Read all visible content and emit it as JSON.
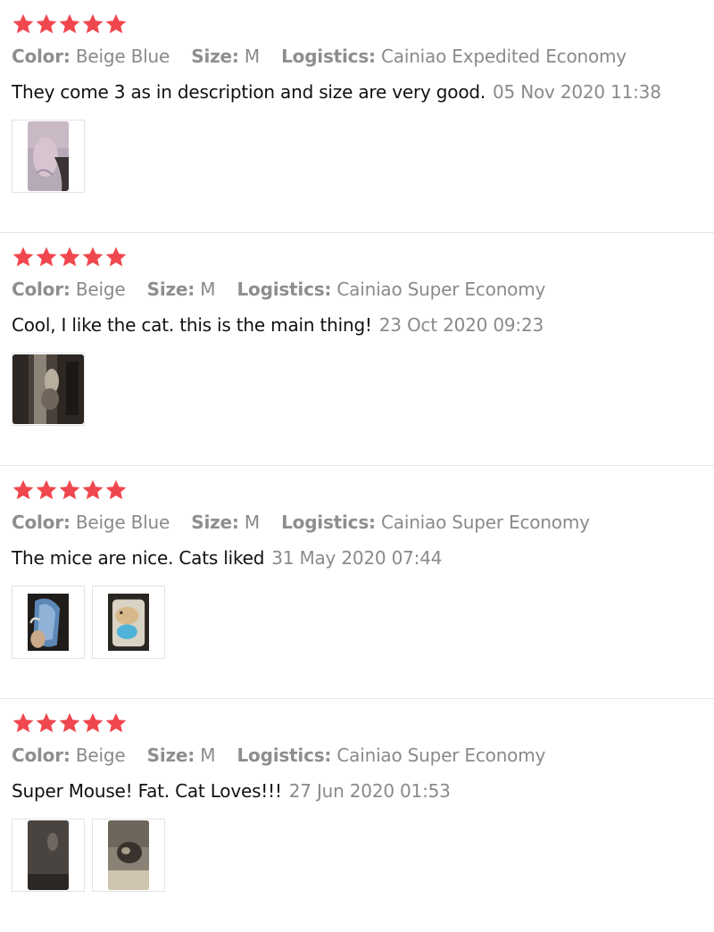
{
  "colors": {
    "star": "#f0474e",
    "muted": "#8a8a8a",
    "text": "#111111",
    "divider": "#e6e6e6"
  },
  "labels": {
    "color": "Color:",
    "size": "Size:",
    "logistics": "Logistics:"
  },
  "reviews": [
    {
      "rating": 5,
      "color": "Beige Blue",
      "size": "M",
      "logistics": "Cainiao Expedited Economy",
      "comment": "They come 3 as in description and size are very good.",
      "date": "05 Nov 2020 11:38",
      "photos": [
        "pale-pink-toy-photo"
      ]
    },
    {
      "rating": 5,
      "color": "Beige",
      "size": "M",
      "logistics": "Cainiao Super Economy",
      "comment": "Cool, I like the cat. this is the main thing!",
      "date": "23 Oct 2020 09:23",
      "photos": [
        "cat-on-door-photo"
      ]
    },
    {
      "rating": 5,
      "color": "Beige Blue",
      "size": "M",
      "logistics": "Cainiao Super Economy",
      "comment": "The mice are nice. Cats liked",
      "date": "31 May 2020 07:44",
      "photos": [
        "blue-mouse-in-hand-photo",
        "mice-in-package-photo"
      ]
    },
    {
      "rating": 5,
      "color": "Beige",
      "size": "M",
      "logistics": "Cainiao Super Economy",
      "comment": "Super Mouse! Fat. Cat Loves!!!",
      "date": "27 Jun 2020 01:53",
      "photos": [
        "dark-floor-toy-photo",
        "cat-with-mouse-photo"
      ]
    }
  ]
}
